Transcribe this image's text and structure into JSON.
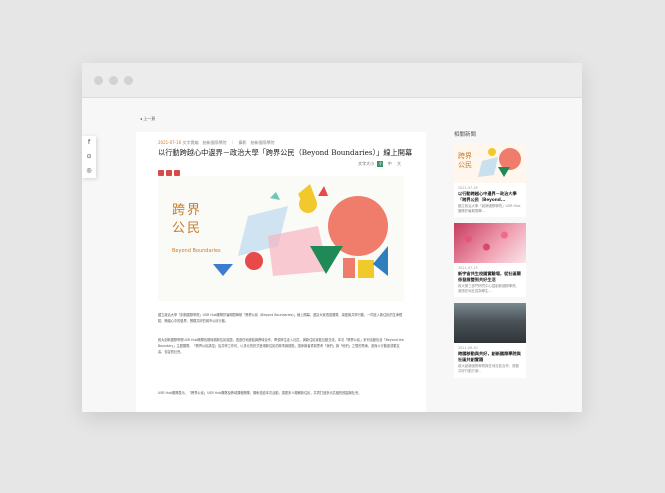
{
  "nav": {
    "back_label": "上一頁"
  },
  "share": {
    "items": [
      "f",
      "⊙",
      "◎"
    ]
  },
  "article": {
    "date": "2021-07-16",
    "byline": "文字責編　創新國際學院　｜　攝影　創新國際學院",
    "title": "以行動跨越心中邊界－政治大學「跨界公民（Beyond Boundaries）」線上開幕",
    "font_size_label": "文字大小",
    "font_sizes": [
      "小",
      "中",
      "大"
    ],
    "badge_colors": [
      "#d94a4a",
      "#d94a4a",
      "#d94a4a"
    ],
    "banner": {
      "title": "跨界公民",
      "subtitle": "Beyond Boundaries"
    },
    "paragraphs": [
      "國立政治大學「創新國際學院」USR Hub團隊於暑期間舉辦「跨界公民（Beyond Boundaries）」線上開幕，邀請大家透過展覽、講座與共學行動，一同走入新住民的生命經驗，跨越心中的邊界，實踐共好的城市公民行動。",
      "政大創新國際學院USR Hub團隊長期深耕新住民議題，透過在地連結與跨域合作，帶領學生走入社區，與新住民家庭互動交流。本次「跨界公民」系列活動包含「Beyond the Boundary」主題展覽、「跨界公民講堂」及共學工作坊，以多元的形式呈現新住民的故事與觀點，讓參與者重新思考「我們」與「他們」之間的界線，進而以行動促成更友善、包容的社會。",
      "USR Hub團隊表示，「跨界公民」USR Hub團隊及跨域課程團隊，期盼透過本次活動，讓更多人理解新住民，共同打造多元共融的校園與社會。"
    ]
  },
  "related": {
    "heading": "相關新聞",
    "items": [
      {
        "date": "2021-07-16",
        "title": "以行動跨越心中邊界－政治大學「跨界公民（Beyond...",
        "desc": "國立政治大學「創新國際學院」USR Hub團隊於暑期間舉..."
      },
      {
        "date": "2021-07-15",
        "title": "新宇宙共生校園實驗場，從社區關係發展營到共好生活",
        "desc": "政大第三部門研究中心暨創新國際學院，邀請在地社區與學生..."
      },
      {
        "date": "2021-06-30",
        "title": "跨國移動與共好，創新國際學院與社區共創實踐",
        "desc": "政大創新國際學院與在地社區合作，推動共好行動方案..."
      }
    ]
  }
}
